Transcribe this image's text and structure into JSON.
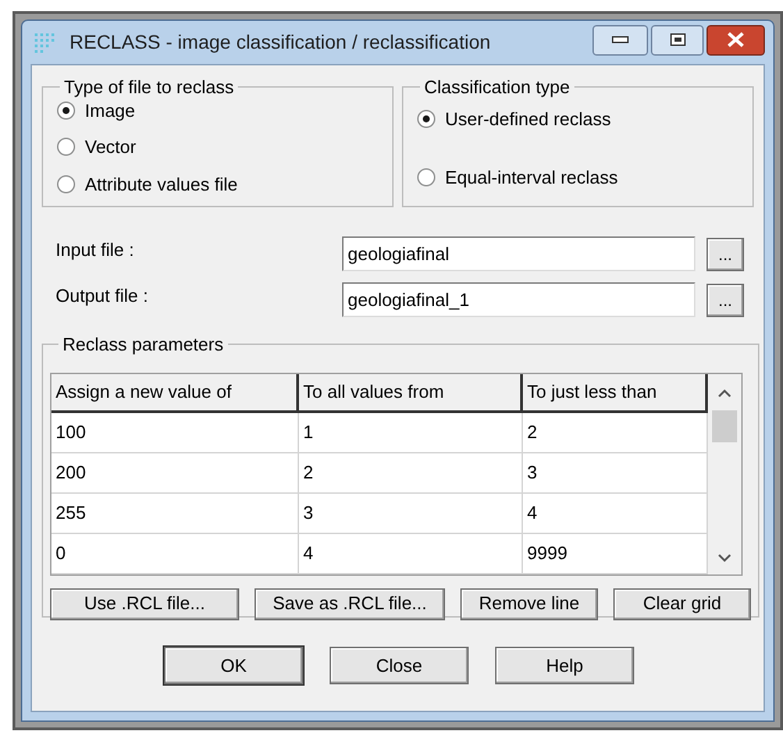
{
  "window": {
    "title": "RECLASS - image classification / reclassification"
  },
  "file_type": {
    "label": "Type of file to reclass",
    "options": [
      {
        "label": "Image",
        "selected": true
      },
      {
        "label": "Vector",
        "selected": false
      },
      {
        "label": "Attribute values file",
        "selected": false
      }
    ]
  },
  "classification_type": {
    "label": "Classification type",
    "options": [
      {
        "label": "User-defined reclass",
        "selected": true
      },
      {
        "label": "Equal-interval reclass",
        "selected": false
      }
    ]
  },
  "files": [
    {
      "label": "Input file :",
      "value": "geologiafinal",
      "browse": "..."
    },
    {
      "label": "Output file :",
      "value": "geologiafinal_1",
      "browse": "..."
    }
  ],
  "reclass_parameters": {
    "label": "Reclass parameters",
    "columns": [
      "Assign a new value of",
      "To all values from",
      "To just less than"
    ],
    "rows": [
      [
        "100",
        "1",
        "2"
      ],
      [
        "200",
        "2",
        "3"
      ],
      [
        "255",
        "3",
        "4"
      ],
      [
        "0",
        "4",
        "9999"
      ]
    ],
    "buttons": [
      "Use .RCL file...",
      "Save as .RCL file...",
      "Remove line",
      "Clear grid"
    ]
  },
  "buttons": [
    "OK",
    "Close",
    "Help"
  ]
}
